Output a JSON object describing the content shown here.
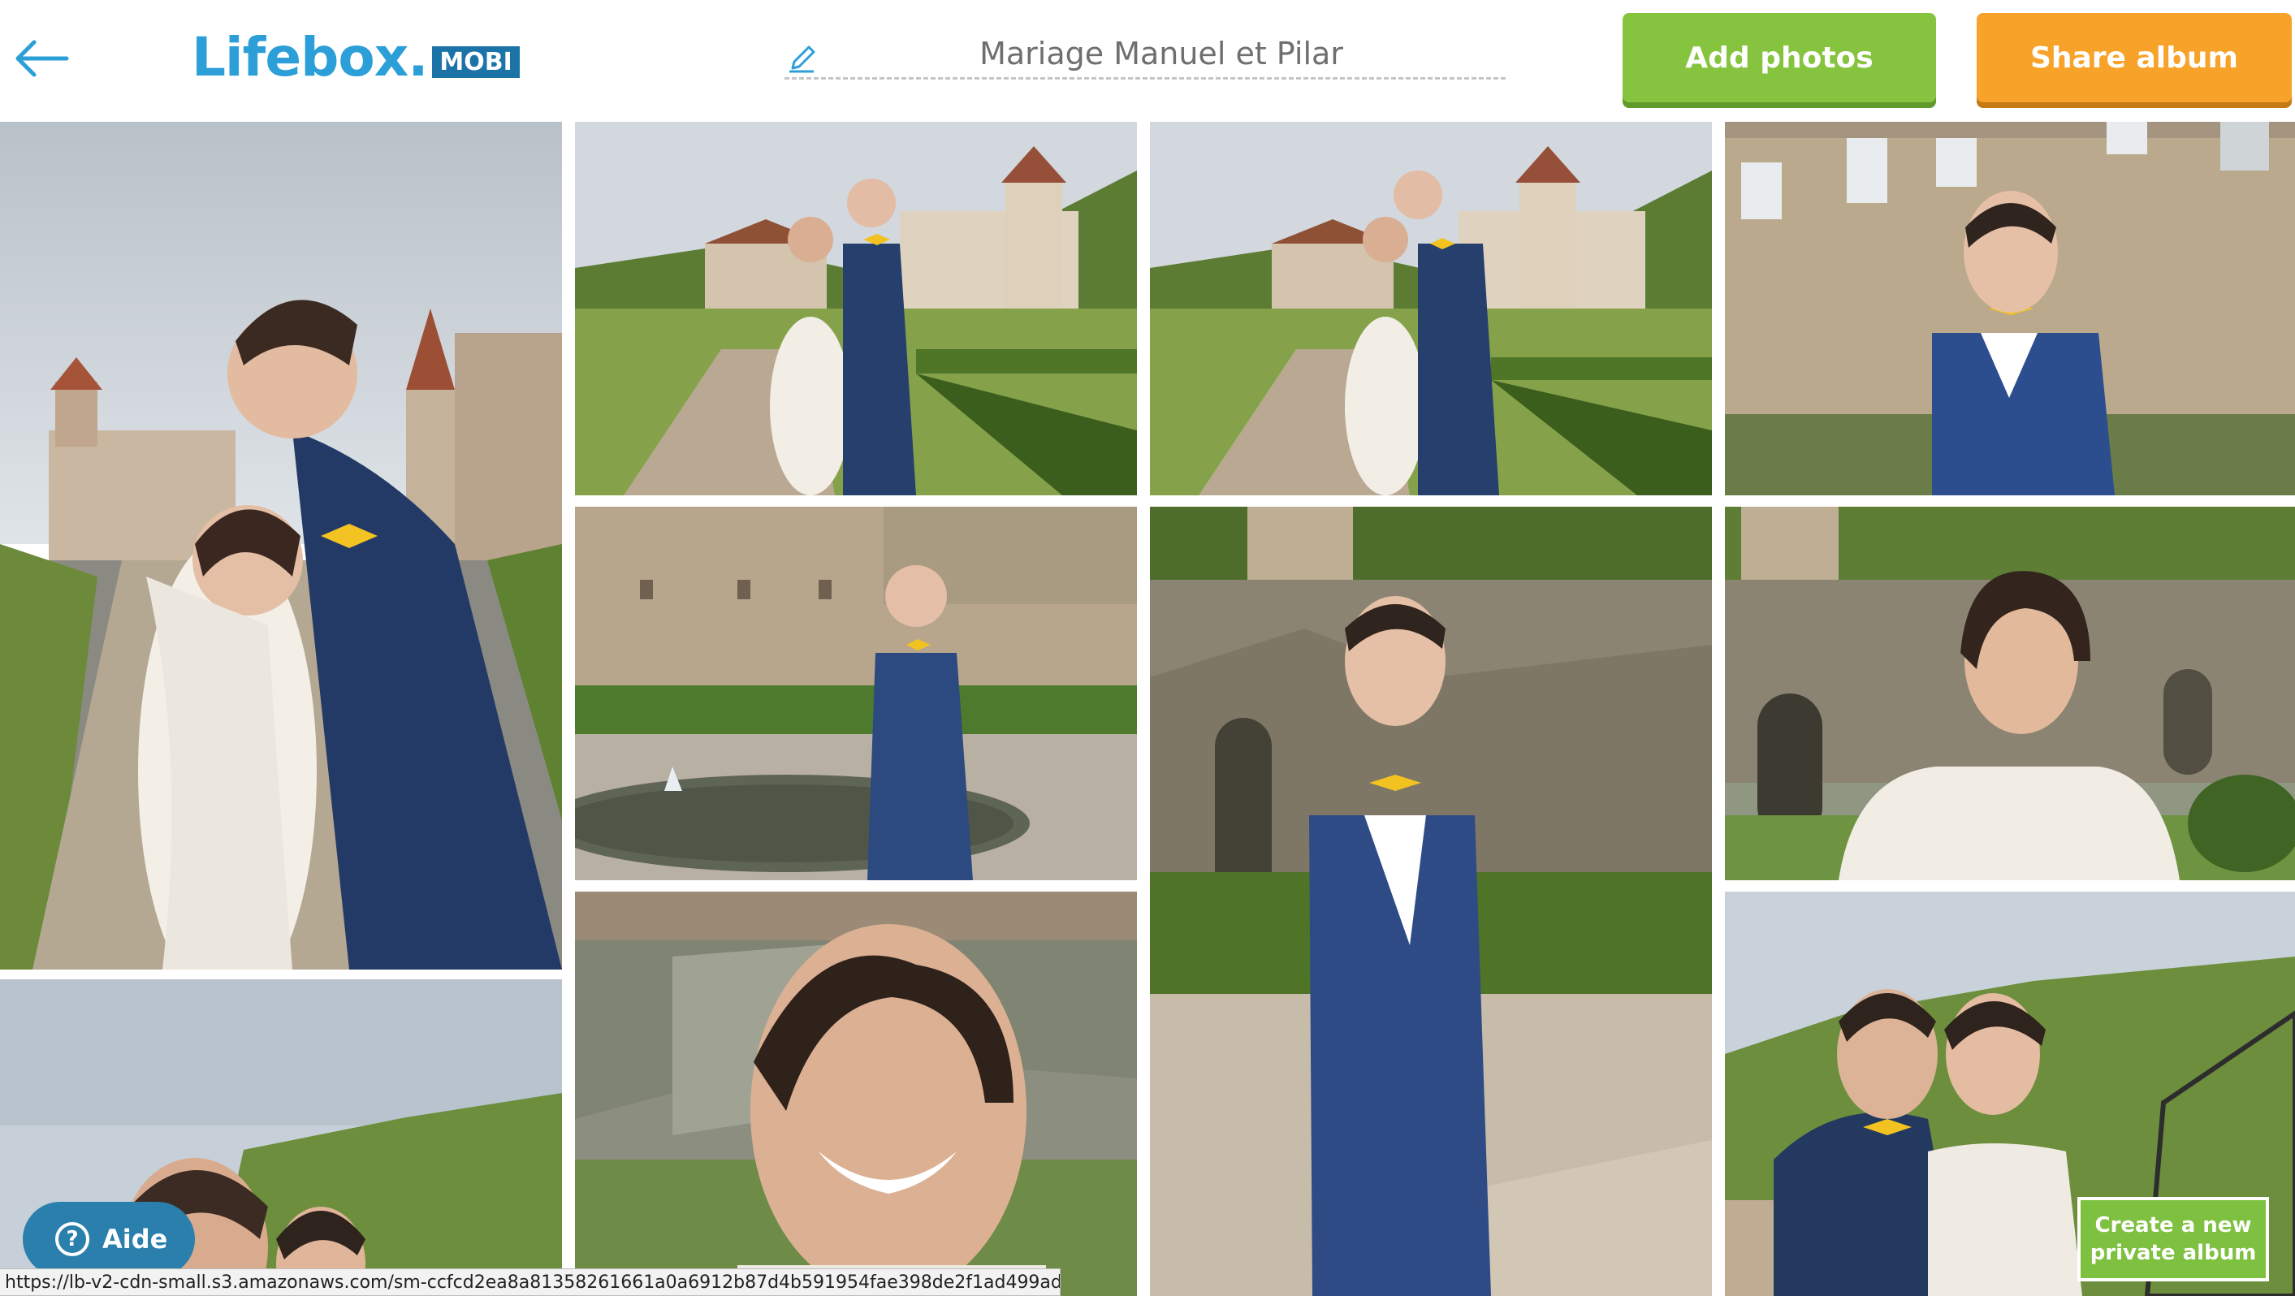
{
  "header": {
    "back_icon": "arrow-left-icon",
    "logo": {
      "name": "Lifebox.",
      "badge": "MOBI"
    },
    "album_title": "Mariage Manuel et Pilar",
    "edit_icon": "pencil-icon",
    "add_photos_label": "Add photos",
    "share_album_label": "Share album"
  },
  "colors": {
    "brand_blue": "#2c9fd8",
    "badge_blue": "#1c73a8",
    "add_green": "#86c440",
    "share_orange": "#f7a229",
    "help_blue": "#2a7fad",
    "create_green": "#7ec03f"
  },
  "photos": [
    {
      "id": "photo-1",
      "scene": "couple-embrace-garden-path"
    },
    {
      "id": "photo-2",
      "scene": "couple-standing-castle-garden"
    },
    {
      "id": "photo-3",
      "scene": "couple-standing-castle-garden-2"
    },
    {
      "id": "photo-4",
      "scene": "groom-smiling-facade"
    },
    {
      "id": "photo-5",
      "scene": "groom-by-fountain"
    },
    {
      "id": "photo-6",
      "scene": "groom-full-stone-stairs"
    },
    {
      "id": "photo-7",
      "scene": "bride-smiling-stairs"
    },
    {
      "id": "photo-8",
      "scene": "couple-embrace-sky"
    },
    {
      "id": "photo-9",
      "scene": "bride-closeup-portrait"
    },
    {
      "id": "photo-10",
      "scene": "couple-embrace-hillside"
    }
  ],
  "help": {
    "label": "Aide",
    "icon": "question-icon"
  },
  "create_album": {
    "line1": "Create a new",
    "line2": "private album"
  },
  "status_url": "https://lb-v2-cdn-small.s3.amazonaws.com/sm-ccfcd2ea8a81358261661a0a6912b87d4b591954fae398de2f1ad499ad5e5d0"
}
